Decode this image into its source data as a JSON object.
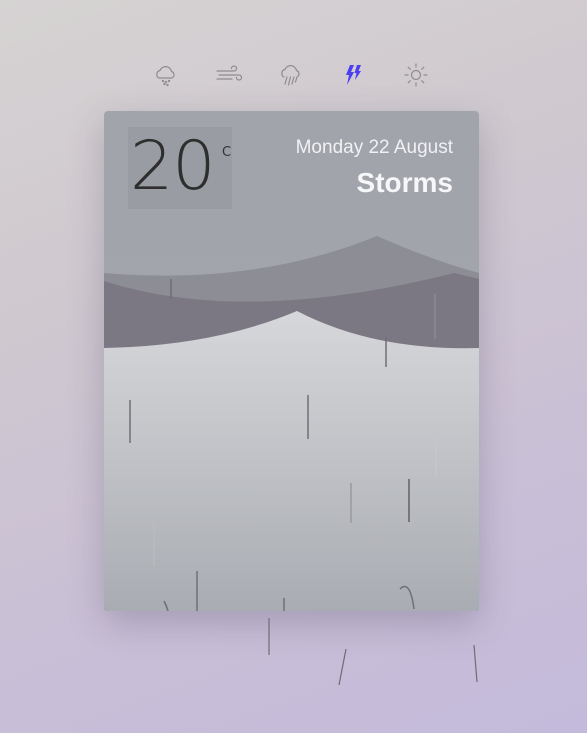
{
  "nav": {
    "items": [
      {
        "icon": "snow-cloud-icon",
        "active": false
      },
      {
        "icon": "wind-icon",
        "active": false
      },
      {
        "icon": "rain-cloud-icon",
        "active": false
      },
      {
        "icon": "lightning-icon",
        "active": true
      },
      {
        "icon": "sun-icon",
        "active": false
      }
    ],
    "active_color": "#4b3ff2",
    "inactive_color": "#8f8c90"
  },
  "weather": {
    "temperature": "20",
    "unit": "C",
    "date": "Monday 22 August",
    "condition": "Storms"
  }
}
